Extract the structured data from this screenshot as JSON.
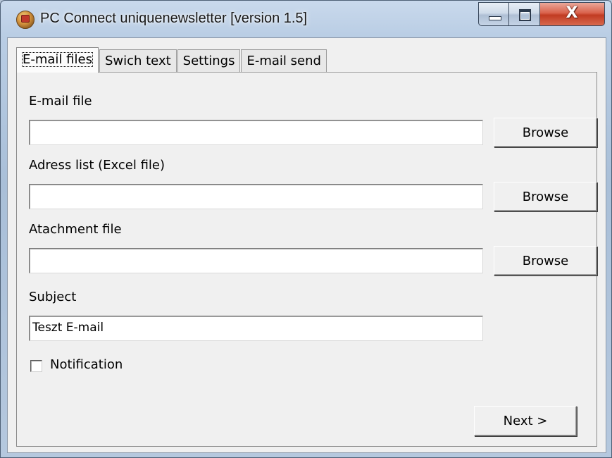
{
  "window": {
    "title": "PC Connect uniquenewsletter [version 1.5]",
    "close_glyph": "X"
  },
  "tabs": [
    {
      "label": "E-mail files",
      "active": true
    },
    {
      "label": "Swich text",
      "active": false
    },
    {
      "label": "Settings",
      "active": false
    },
    {
      "label": "E-mail send",
      "active": false
    }
  ],
  "form": {
    "email_file": {
      "label": "E-mail file",
      "value": "",
      "browse_label": "Browse"
    },
    "address_list": {
      "label": "Adress list (Excel file)",
      "value": "",
      "browse_label": "Browse"
    },
    "attachment_file": {
      "label": "Atachment file",
      "value": "",
      "browse_label": "Browse"
    },
    "subject": {
      "label": "Subject",
      "value": "Teszt E-mail"
    },
    "notification": {
      "label": "Notification",
      "checked": false
    },
    "next_label": "Next >"
  }
}
